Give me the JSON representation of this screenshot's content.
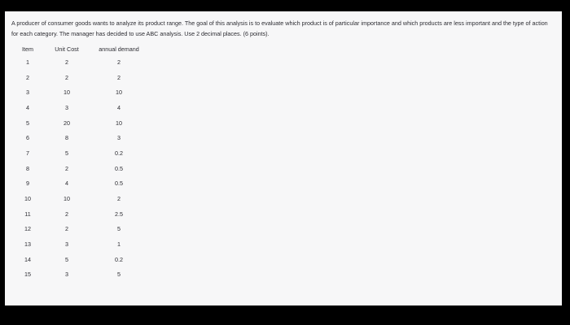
{
  "question": {
    "text": "A producer of consumer goods wants to analyze its product range. The goal of this analysis is to evaluate which product is of particular importance and which products are less important and the type of action for each category. The manager has decided to use ABC analysis. Use 2 decimal places. (6 points)."
  },
  "table": {
    "headers": [
      "Item",
      "Unit Cost",
      "annual demand"
    ],
    "rows": [
      [
        "1",
        "2",
        "2"
      ],
      [
        "2",
        "2",
        "2"
      ],
      [
        "3",
        "10",
        "10"
      ],
      [
        "4",
        "3",
        "4"
      ],
      [
        "5",
        "20",
        "10"
      ],
      [
        "6",
        "8",
        "3"
      ],
      [
        "7",
        "5",
        "0.2"
      ],
      [
        "8",
        "2",
        "0.5"
      ],
      [
        "9",
        "4",
        "0.5"
      ],
      [
        "10",
        "10",
        "2"
      ],
      [
        "11",
        "2",
        "2.5"
      ],
      [
        "12",
        "2",
        "5"
      ],
      [
        "13",
        "3",
        "1"
      ],
      [
        "14",
        "5",
        "0.2"
      ],
      [
        "15",
        "3",
        "5"
      ]
    ]
  }
}
